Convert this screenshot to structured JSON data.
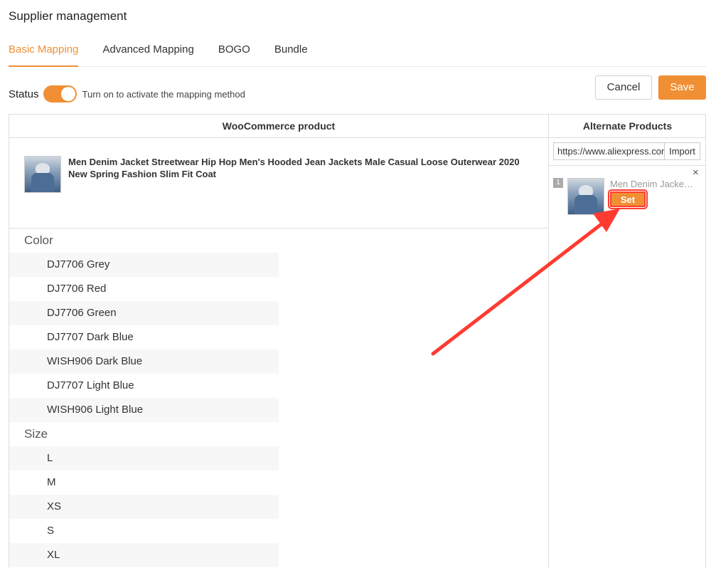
{
  "page_title": "Supplier management",
  "tabs": [
    {
      "label": "Basic Mapping",
      "active": true
    },
    {
      "label": "Advanced Mapping",
      "active": false
    },
    {
      "label": "BOGO",
      "active": false
    },
    {
      "label": "Bundle",
      "active": false
    }
  ],
  "status": {
    "label": "Status",
    "enabled": true,
    "hint": "Turn on to activate the mapping method"
  },
  "actions": {
    "cancel_label": "Cancel",
    "save_label": "Save"
  },
  "woocommerce": {
    "header": "WooCommerce product",
    "product_title": "Men Denim Jacket Streetwear Hip Hop Men's Hooded Jean Jackets Male Casual Loose Outerwear 2020 New Spring Fashion Slim Fit Coat",
    "attributes": [
      {
        "name": "Color",
        "values": [
          "DJ7706 Grey",
          "DJ7706 Red",
          "DJ7706 Green",
          "DJ7707 Dark Blue",
          "WISH906 Dark Blue",
          "DJ7707 Light Blue",
          "WISH906 Light Blue"
        ]
      },
      {
        "name": "Size",
        "values": [
          "L",
          "M",
          "XS",
          "S",
          "XL"
        ]
      }
    ]
  },
  "alternate": {
    "header": "Alternate Products",
    "url_value": "https://www.aliexpress.com",
    "import_label": "Import",
    "items": [
      {
        "index": "1",
        "title": "Men Denim Jacket Streetwear",
        "set_label": "Set",
        "close": "×"
      }
    ]
  },
  "colors": {
    "accent": "#f08f33",
    "annotation": "#ff3b30"
  }
}
